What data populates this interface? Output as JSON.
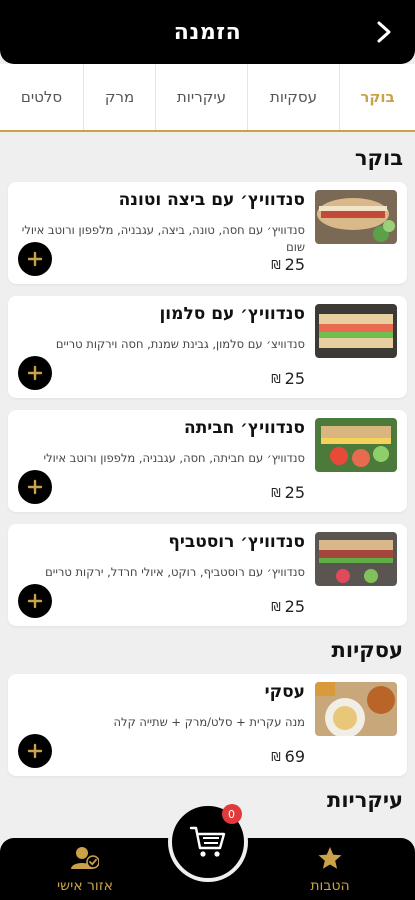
{
  "header": {
    "title": "הזמנה",
    "back_icon": "chevron-right-icon"
  },
  "tabs": [
    {
      "label": "בוקר",
      "active": true
    },
    {
      "label": "עסקיות"
    },
    {
      "label": "עיקריות"
    },
    {
      "label": "מרק"
    },
    {
      "label": "סלטים"
    }
  ],
  "sections": [
    {
      "title": "בוקר",
      "items": [
        {
          "name": "סנדוויץ׳ עם ביצה וטונה",
          "desc": "סנדוויץ׳ עם חסה, טונה, ביצה, עגבניה, מלפפון ורוטב איולי שום",
          "price": "25",
          "currency": "₪"
        },
        {
          "name": "סנדוויץ׳ עם סלמון",
          "desc": "סנדוויצ׳ עם סלמון, גבינת שמנת, חסה וירקות טריים",
          "price": "25",
          "currency": "₪"
        },
        {
          "name": "סנדוויץ׳ חביתה",
          "desc": "סנדוויץ׳ עם חביתה, חסה, עגבניה, מלפפון ורוטב איולי",
          "price": "25",
          "currency": "₪"
        },
        {
          "name": "סנדוויץ׳ רוסטביף",
          "desc": "סנדוויץ׳ עם רוסטביף, רוקט, איולי חרדל, ירקות טריים",
          "price": "25",
          "currency": "₪"
        }
      ]
    },
    {
      "title": "עסקיות",
      "items": [
        {
          "name": "עסקי",
          "desc": "מנה עקרית + סלט/מרק + שתייה קלה",
          "price": "69",
          "currency": "₪"
        }
      ]
    },
    {
      "title": "עיקריות",
      "items": []
    }
  ],
  "bottom_nav": {
    "promotions_label": "הטבות",
    "account_label": "אזור אישי",
    "cart_count": "0"
  },
  "colors": {
    "accent": "#c9a24a",
    "dark": "#000000",
    "badge": "#e23a3a",
    "background": "#efefef"
  }
}
